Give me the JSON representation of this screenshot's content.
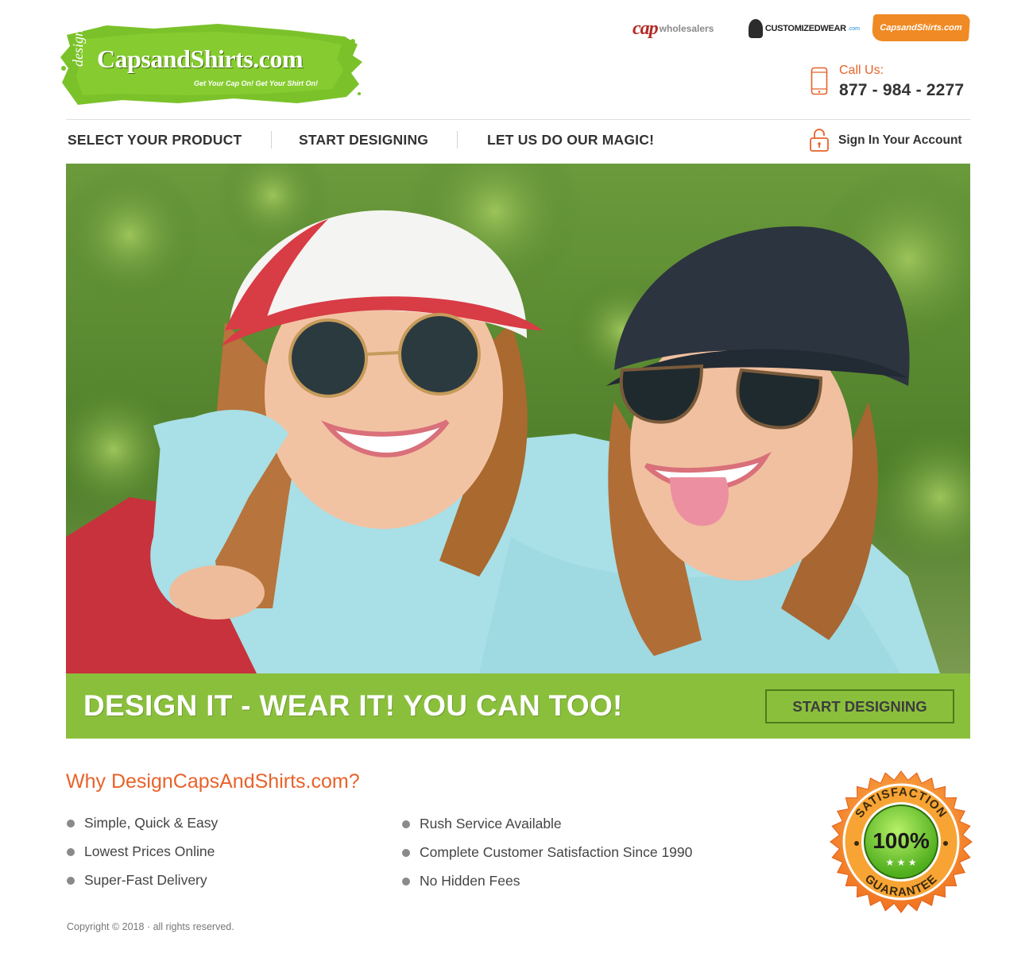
{
  "logo": {
    "design": "design",
    "main": "CapsandShirts.com",
    "tagline": "Get Your Cap On! Get Your Shirt On!"
  },
  "partners": {
    "capwholesalers": {
      "cap": "cap",
      "rest": "wholesalers"
    },
    "customizedwear": {
      "text": "CUSTOMIZEDWEAR",
      "com": ".com"
    },
    "capsandshirts": {
      "text": "CapsandShirts.com"
    }
  },
  "contact": {
    "label": "Call Us:",
    "phone": "877 - 984 - 2277"
  },
  "nav": {
    "items": [
      {
        "label": "SELECT YOUR PRODUCT"
      },
      {
        "label": "START DESIGNING"
      },
      {
        "label": "LET US DO OUR MAGIC!"
      }
    ],
    "sign_in": "Sign In Your Account"
  },
  "hero": {
    "banner_text": "DESIGN IT - WEAR IT!  YOU CAN TOO!",
    "cta": "START DESIGNING"
  },
  "why": {
    "title": "Why DesignCapsAndShirts.com?",
    "features_left": [
      "Simple, Quick & Easy",
      "Lowest Prices Online",
      "Super-Fast Delivery"
    ],
    "features_right": [
      "Rush Service Available",
      "Complete Customer Satisfaction Since 1990",
      "No Hidden Fees"
    ]
  },
  "badge": {
    "top": "SATISFACTION",
    "percent": "100%",
    "bottom": "GUARANTEE"
  },
  "footer": {
    "copyright": "Copyright © 2018 · all rights reserved."
  },
  "colors": {
    "accent_orange": "#e8622a",
    "brand_green": "#8abf3c",
    "text_dark": "#333333"
  }
}
